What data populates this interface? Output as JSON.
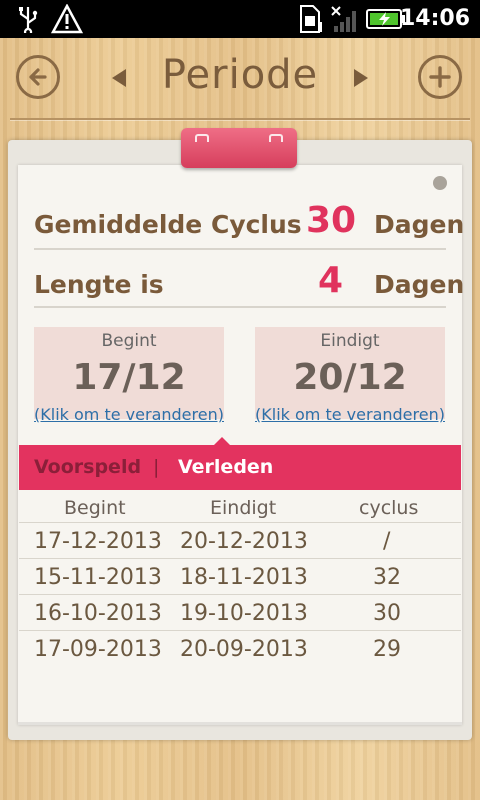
{
  "statusbar": {
    "icons": [
      "usb-icon",
      "warning-icon",
      "sim-icon",
      "no-signal-icon",
      "signal-icon",
      "battery-charging-icon"
    ],
    "time": "14:06"
  },
  "header": {
    "title": "Periode",
    "back_icon": "circle-left-arrow",
    "prev_icon": "triangle-left",
    "next_icon": "triangle-right",
    "add_icon": "circle-plus"
  },
  "summary": {
    "avg_cycle_label": "Gemiddelde Cyclus",
    "avg_cycle_value": "30",
    "avg_cycle_unit": "Dagen",
    "length_label": "Lengte is",
    "length_value": "4",
    "length_unit": "Dagen"
  },
  "dates": {
    "start_label": "Begint",
    "start_value": "17/12",
    "start_link": "(Klik om te veranderen)",
    "end_label": "Eindigt",
    "end_value": "20/12",
    "end_link": "(Klik om te veranderen)"
  },
  "tabs": {
    "predicted": "Voorspeld",
    "separator": "|",
    "past": "Verleden",
    "active": "past"
  },
  "table": {
    "headers": [
      "Begint",
      "Eindigt",
      "cyclus"
    ],
    "rows": [
      [
        "17-12-2013",
        "20-12-2013",
        "/"
      ],
      [
        "15-11-2013",
        "18-11-2013",
        "32"
      ],
      [
        "16-10-2013",
        "19-10-2013",
        "30"
      ],
      [
        "17-09-2013",
        "20-09-2013",
        "29"
      ]
    ]
  },
  "colors": {
    "accent": "#e3335f",
    "brown_text": "#7a5a3a",
    "link": "#2d6fa8"
  }
}
